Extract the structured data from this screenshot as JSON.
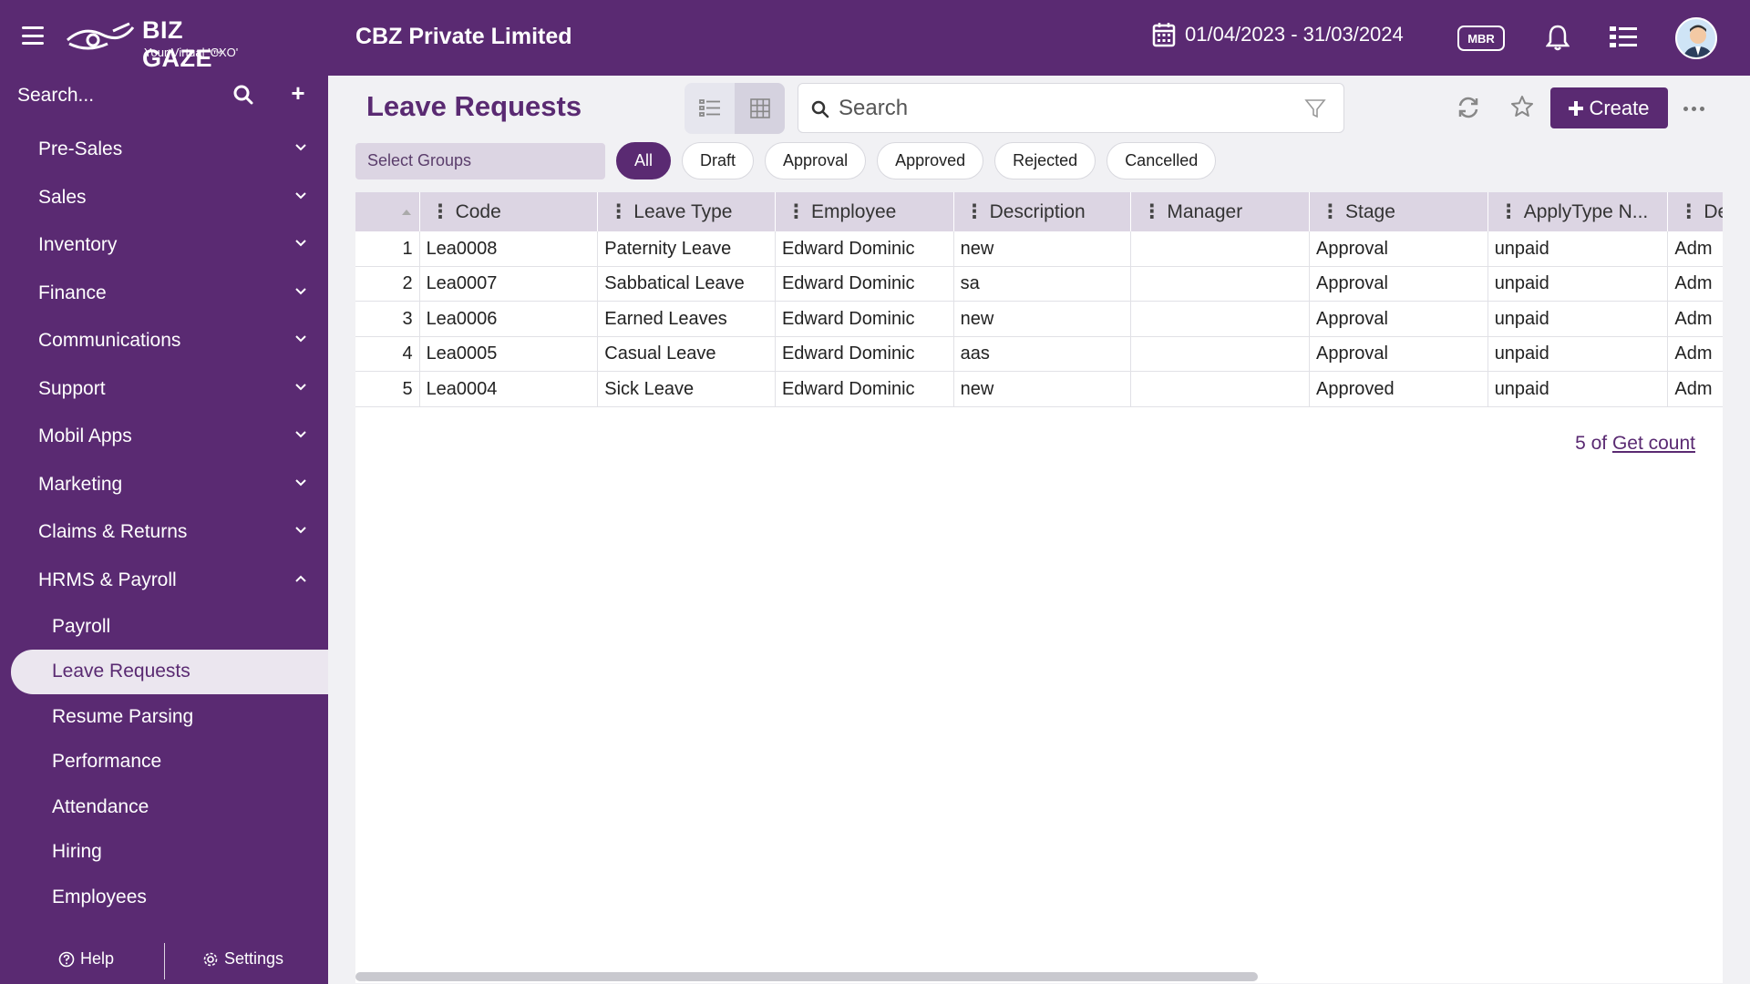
{
  "header": {
    "logo_name": "BIZ GAZE",
    "logo_tm": "™",
    "logo_tagline": "Your Virtual 'CXO'",
    "company": "CBZ Private Limited",
    "date_range": "01/04/2023 - 31/03/2024",
    "badge": "MBR"
  },
  "sidebar": {
    "search_label": "Search...",
    "plus": "+",
    "items": [
      {
        "label": "Pre-Sales"
      },
      {
        "label": "Sales"
      },
      {
        "label": "Inventory"
      },
      {
        "label": "Finance"
      },
      {
        "label": "Communications"
      },
      {
        "label": "Support"
      },
      {
        "label": "Mobil Apps"
      },
      {
        "label": "Marketing"
      },
      {
        "label": "Claims & Returns"
      },
      {
        "label": "HRMS & Payroll"
      }
    ],
    "subitems": [
      {
        "label": "Payroll"
      },
      {
        "label": "Leave Requests"
      },
      {
        "label": "Resume Parsing"
      },
      {
        "label": "Performance"
      },
      {
        "label": "Attendance"
      },
      {
        "label": "Hiring"
      },
      {
        "label": "Employees"
      }
    ],
    "footer": {
      "help": "Help",
      "settings": "Settings"
    }
  },
  "main": {
    "title": "Leave Requests",
    "search_placeholder": "Search",
    "create_label": "Create",
    "groups_placeholder": "Select Groups",
    "chips": [
      "All",
      "Draft",
      "Approval",
      "Approved",
      "Rejected",
      "Cancelled"
    ],
    "active_chip": "All",
    "columns": [
      "",
      "Code",
      "Leave Type",
      "Employee",
      "Description",
      "Manager",
      "Stage",
      "ApplyType N...",
      "De"
    ],
    "rows": [
      [
        "1",
        "Lea0008",
        "Paternity Leave",
        "Edward Dominic",
        "new",
        "",
        "Approval",
        "unpaid",
        "Adm"
      ],
      [
        "2",
        "Lea0007",
        "Sabbatical Leave",
        "Edward Dominic",
        "sa",
        "",
        "Approval",
        "unpaid",
        "Adm"
      ],
      [
        "3",
        "Lea0006",
        "Earned Leaves",
        "Edward Dominic",
        "new",
        "",
        "Approval",
        "unpaid",
        "Adm"
      ],
      [
        "4",
        "Lea0005",
        "Casual Leave",
        "Edward Dominic",
        "aas",
        "",
        "Approval",
        "unpaid",
        "Adm"
      ],
      [
        "5",
        "Lea0004",
        "Sick Leave",
        "Edward Dominic",
        "new",
        "",
        "Approved",
        "unpaid",
        "Adm"
      ]
    ],
    "count_prefix": "5 of",
    "count_link": "Get count"
  },
  "colors": {
    "brand": "#5a2a72",
    "header_row": "#dcd5e3",
    "active_item": "#ebe6ef"
  },
  "icons": [
    "hamburger-icon",
    "calendar-icon",
    "bell-icon",
    "list-icon",
    "search-icon",
    "filter-icon",
    "refresh-icon",
    "star-icon",
    "plus-icon",
    "more-icon",
    "chevron-down-icon",
    "chevron-up-icon",
    "help-icon",
    "gear-icon"
  ]
}
